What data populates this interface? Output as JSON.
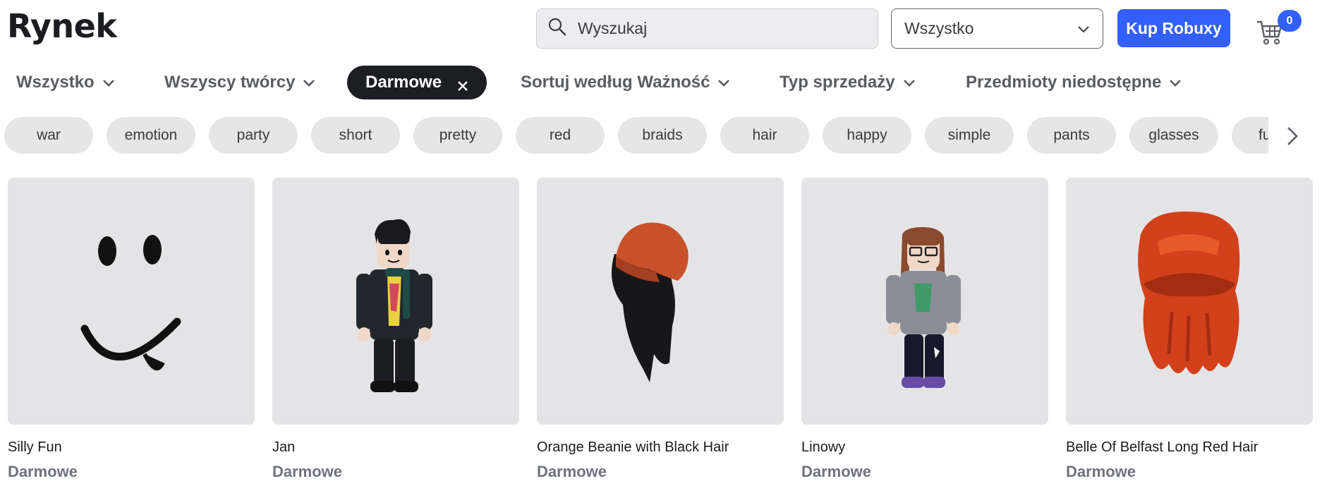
{
  "header": {
    "title": "Rynek",
    "search_placeholder": "Wyszukaj",
    "category_select": "Wszystko",
    "buy_button": "Kup Robuxy",
    "cart_count": "0"
  },
  "filters": {
    "category": "Wszystko",
    "creators": "Wszyscy twórcy",
    "active": "Darmowe",
    "sort": "Sortuj według Ważność",
    "sale_type": "Typ sprzedaży",
    "unavailable": "Przedmioty niedostępne"
  },
  "tags": [
    "war",
    "emotion",
    "party",
    "short",
    "pretty",
    "red",
    "braids",
    "hair",
    "happy",
    "simple",
    "pants",
    "glasses",
    "fu"
  ],
  "items": [
    {
      "name": "Silly Fun",
      "price": "Darmowe"
    },
    {
      "name": "Jan",
      "price": "Darmowe"
    },
    {
      "name": "Orange Beanie with Black Hair",
      "price": "Darmowe"
    },
    {
      "name": "Linowy",
      "price": "Darmowe"
    },
    {
      "name": "Belle Of Belfast Long Red Hair",
      "price": "Darmowe"
    }
  ],
  "icons": {
    "search": "search-icon",
    "select": "chevron-down-icon",
    "cart": "cart-icon",
    "remove_filter": "close-icon",
    "scroll_tags": "chevron-right-icon"
  },
  "colors": {
    "accent": "#335fff",
    "active_filter": "#1c1e22",
    "tag_bg": "#e6e6e7",
    "thumb_bg": "#e4e4e6"
  }
}
